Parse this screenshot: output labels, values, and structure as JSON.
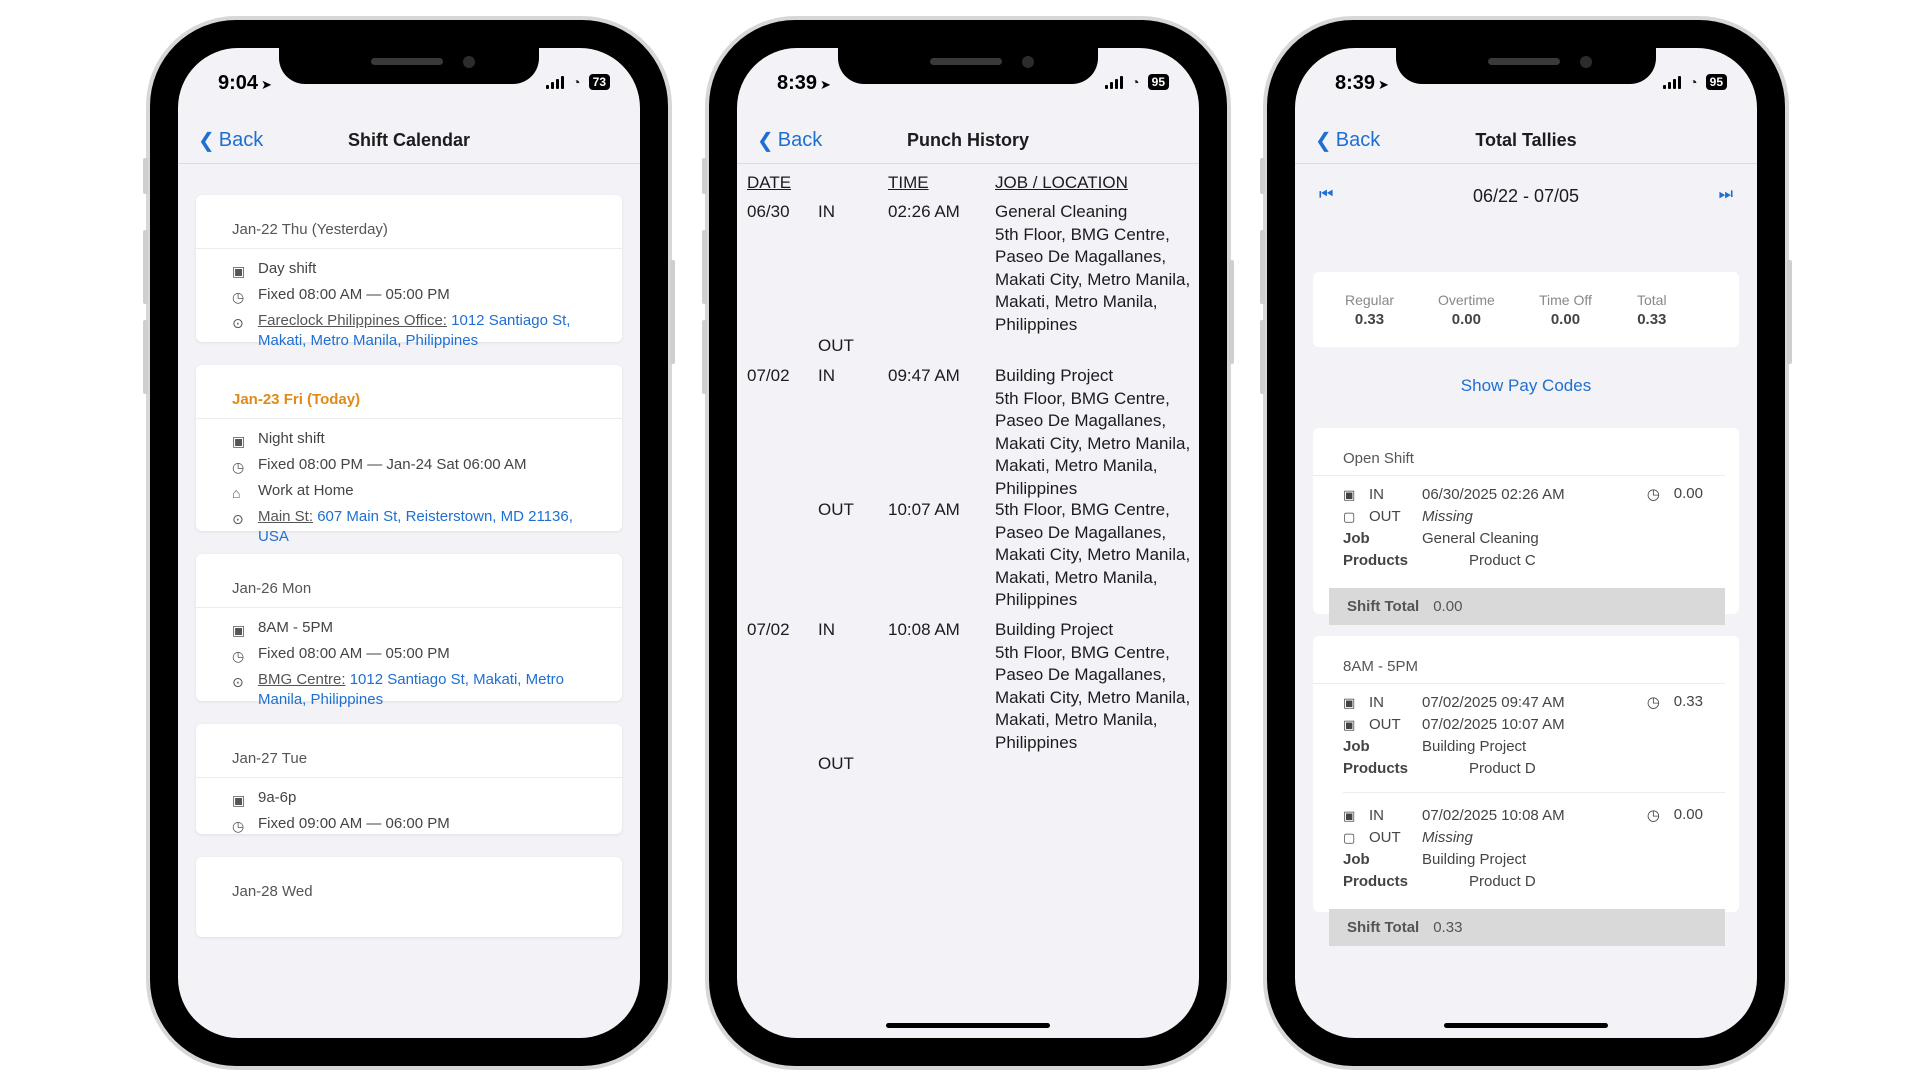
{
  "phone1": {
    "status": {
      "time": "9:04",
      "battery": "73"
    },
    "back": "Back",
    "title": "Shift Calendar",
    "cards": [
      {
        "date": "Jan-22 Thu (Yesterday)",
        "shift": "Day shift",
        "hours": "Fixed 08:00 AM — 05:00 PM",
        "place": "Fareclock Philippines Office:",
        "address": "1012 Santiago St, Makati, Metro Manila, Philippines"
      },
      {
        "date": "Jan-23 Fri (Today)",
        "shift": "Night shift",
        "hours": "Fixed 08:00 PM — Jan-24 Sat 06:00 AM",
        "mode": "Work at Home",
        "place": "Main St:",
        "address": "607 Main St, Reisterstown, MD 21136, USA"
      },
      {
        "date": "Jan-26 Mon",
        "shift": "8AM - 5PM",
        "hours": "Fixed 08:00 AM — 05:00 PM",
        "place": "BMG Centre:",
        "address": "1012 Santiago St, Makati, Metro Manila, Philippines"
      },
      {
        "date": "Jan-27 Tue",
        "shift": "9a-6p",
        "hours": "Fixed 09:00 AM — 06:00 PM"
      },
      {
        "date": "Jan-28 Wed"
      }
    ]
  },
  "phone2": {
    "status": {
      "time": "8:39",
      "battery": "95"
    },
    "back": "Back",
    "title": "Punch History",
    "headers": {
      "date": "DATE",
      "time": "TIME",
      "job": "JOB / LOCATION"
    },
    "entries": [
      {
        "date": "06/30",
        "in_label": "IN",
        "in_time": "02:26 AM",
        "in_job": "General Cleaning\n5th Floor, BMG Centre, Paseo De Magallanes, Makati City, Metro Manila, Makati, Metro Manila, Philippines",
        "out_label": "OUT",
        "out_time": "",
        "out_job": ""
      },
      {
        "date": "07/02",
        "in_label": "IN",
        "in_time": "09:47 AM",
        "in_job": "Building Project\n5th Floor, BMG Centre, Paseo De Magallanes, Makati City, Metro Manila, Makati, Metro Manila, Philippines",
        "out_label": "OUT",
        "out_time": "10:07 AM",
        "out_job": "5th Floor, BMG Centre, Paseo De Magallanes, Makati City, Metro Manila, Makati, Metro Manila, Philippines"
      },
      {
        "date": "07/02",
        "in_label": "IN",
        "in_time": "10:08 AM",
        "in_job": "Building Project\n5th Floor, BMG Centre, Paseo De Magallanes, Makati City, Metro Manila, Makati, Metro Manila, Philippines",
        "out_label": "OUT",
        "out_time": "",
        "out_job": ""
      }
    ]
  },
  "phone3": {
    "status": {
      "time": "8:39",
      "battery": "95"
    },
    "back": "Back",
    "title": "Total Tallies",
    "period": "06/22 - 07/05",
    "totals": [
      {
        "label": "Regular",
        "value": "0.33"
      },
      {
        "label": "Overtime",
        "value": "0.00"
      },
      {
        "label": "Time Off",
        "value": "0.00"
      },
      {
        "label": "Total",
        "value": "0.33"
      }
    ],
    "show_pay_codes": "Show Pay Codes",
    "shifts": [
      {
        "name": "Open Shift",
        "punches": [
          {
            "in": "06/30/2025 02:26 AM",
            "out": "Missing",
            "hours": "0.00",
            "job": "General Cleaning",
            "products": "Product C"
          }
        ],
        "total_label": "Shift Total",
        "total": "0.00"
      },
      {
        "name": "8AM - 5PM",
        "punches": [
          {
            "in": "07/02/2025 09:47 AM",
            "out": "07/02/2025 10:07 AM",
            "hours": "0.33",
            "job": "Building Project",
            "products": "Product D"
          },
          {
            "in": "07/02/2025 10:08 AM",
            "out": "Missing",
            "hours": "0.00",
            "job": "Building Project",
            "products": "Product D"
          }
        ],
        "total_label": "Shift Total",
        "total": "0.33"
      }
    ],
    "labels": {
      "in": "IN",
      "out": "OUT",
      "job": "Job",
      "products": "Products"
    }
  },
  "colors": {
    "accent": "#1f6fd1",
    "today": "#e08a17"
  }
}
